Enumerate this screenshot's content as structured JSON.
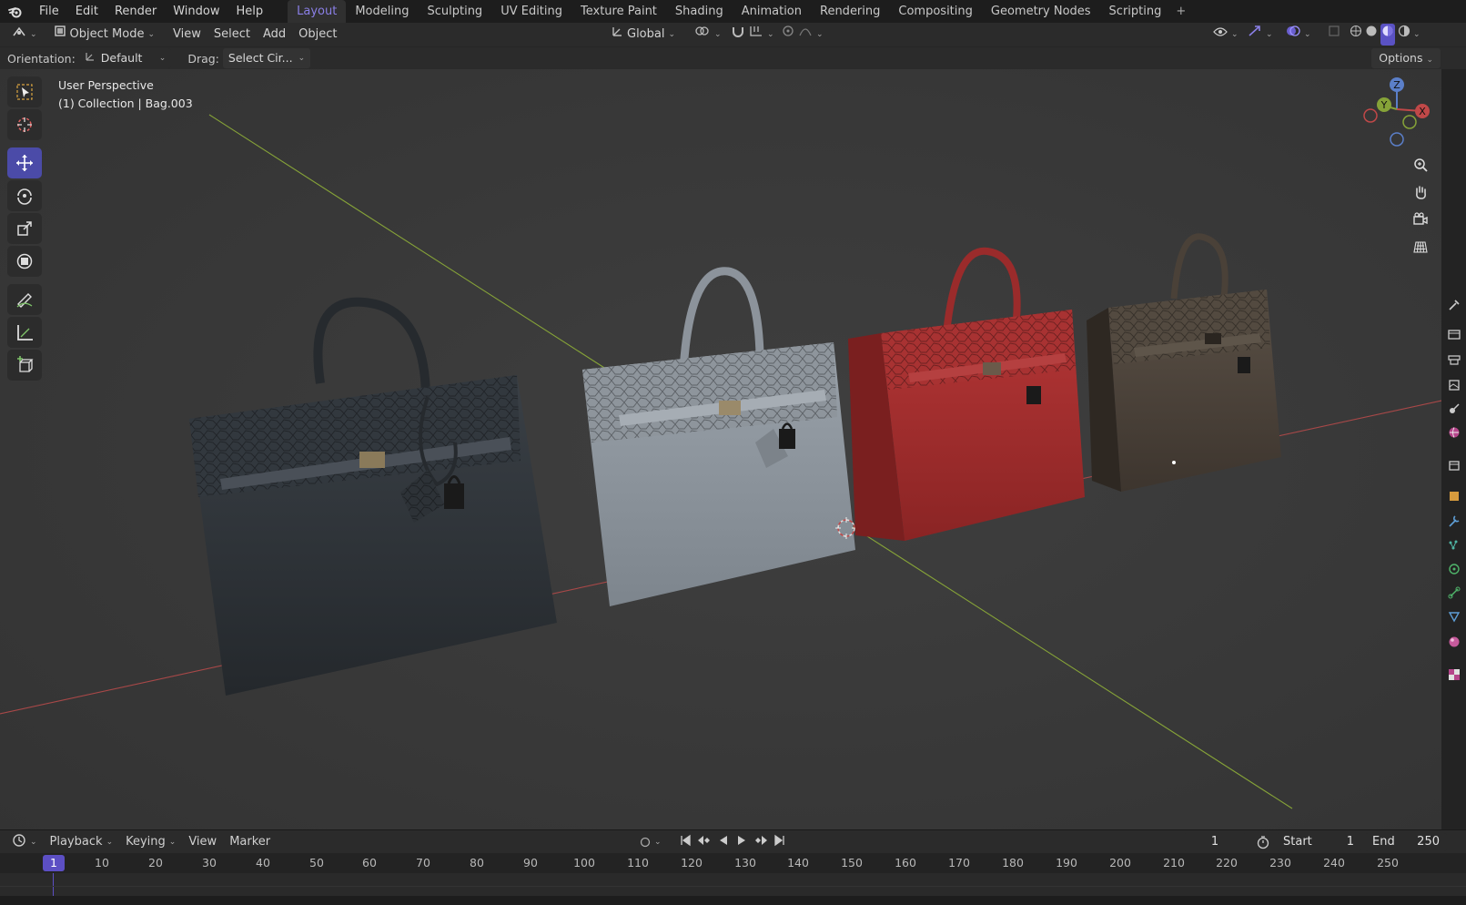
{
  "menu": {
    "items": [
      "File",
      "Edit",
      "Render",
      "Window",
      "Help"
    ]
  },
  "workspaces": {
    "tabs": [
      "Layout",
      "Modeling",
      "Sculpting",
      "UV Editing",
      "Texture Paint",
      "Shading",
      "Animation",
      "Rendering",
      "Compositing",
      "Geometry Nodes",
      "Scripting"
    ],
    "active": "Layout",
    "add_label": "+"
  },
  "header": {
    "mode": "Object Mode",
    "menus": [
      "View",
      "Select",
      "Add",
      "Object"
    ],
    "transform_orientation": "Global"
  },
  "tool_settings": {
    "orientation_label": "Orientation:",
    "orientation_value": "Default",
    "drag_label": "Drag:",
    "drag_value": "Select Cir...",
    "options_label": "Options"
  },
  "viewport": {
    "perspective": "User Perspective",
    "collection_info": "(1) Collection | Bag.003",
    "gizmo_axes": [
      "Z",
      "Y",
      "X"
    ],
    "bag_colors": [
      "#2f3338",
      "#8a9198",
      "#9e2c2c",
      "#4a4138"
    ]
  },
  "toolbar": {
    "tools": [
      "select-box",
      "cursor",
      "move",
      "rotate",
      "scale",
      "transform",
      "annotate",
      "measure",
      "add-cube"
    ],
    "active": "move"
  },
  "timeline": {
    "menus": [
      "Playback",
      "Keying",
      "View",
      "Marker"
    ],
    "current_frame": "1",
    "start_label": "Start",
    "start_value": "1",
    "end_label": "End",
    "end_value": "250",
    "ruler_labels": [
      "1",
      "10",
      "20",
      "30",
      "40",
      "50",
      "60",
      "70",
      "80",
      "90",
      "100",
      "110",
      "120",
      "130",
      "140",
      "150",
      "160",
      "170",
      "180",
      "190",
      "200",
      "210",
      "220",
      "230",
      "240",
      "250"
    ]
  },
  "colors": {
    "accent": "#8a7fe6",
    "active_tool": "#4b4ba8",
    "x_axis": "#c04848",
    "y_axis": "#86a338",
    "z_axis": "#5b7fc9"
  }
}
